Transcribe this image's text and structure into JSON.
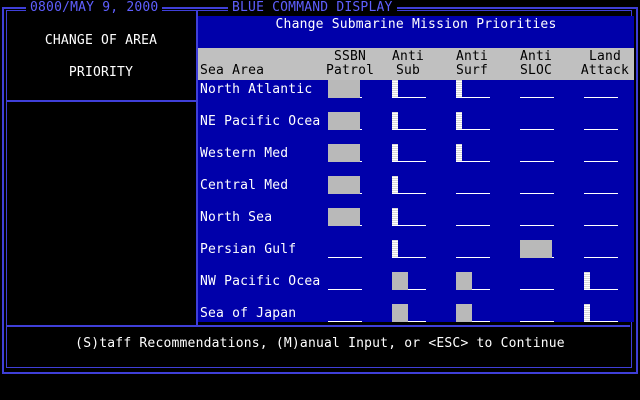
{
  "top_bar": {
    "datetime": "0800/MAY  9, 2000",
    "display_name": "BLUE  COMMAND DISPLAY"
  },
  "left_panel": {
    "line1": "CHANGE OF AREA",
    "line2": "PRIORITY"
  },
  "panel": {
    "title": "Change Submarine Mission Priorities",
    "column_headers": [
      {
        "top": "",
        "bottom": "Sea Area"
      },
      {
        "top": "SSBN",
        "bottom": "Patrol"
      },
      {
        "top": "Anti",
        "bottom": "Sub"
      },
      {
        "top": "Anti",
        "bottom": "Surf"
      },
      {
        "top": "Anti",
        "bottom": "SLOC"
      },
      {
        "top": "Land",
        "bottom": "Attack"
      }
    ],
    "rows": [
      {
        "area": "North Atlantic",
        "levels": [
          1.0,
          0.2,
          0.2,
          0,
          0
        ]
      },
      {
        "area": "NE Pacific Ocea",
        "levels": [
          1.0,
          0.2,
          0.2,
          0,
          0
        ]
      },
      {
        "area": "Western Med",
        "levels": [
          1.0,
          0.2,
          0.2,
          0,
          0
        ]
      },
      {
        "area": "Central Med",
        "levels": [
          1.0,
          0.2,
          0,
          0,
          0
        ]
      },
      {
        "area": "North Sea",
        "levels": [
          1.0,
          0.2,
          0,
          0,
          0
        ]
      },
      {
        "area": "Persian Gulf",
        "levels": [
          0,
          0.2,
          0,
          1.0,
          0
        ]
      },
      {
        "area": "NW Pacific Ocea",
        "levels": [
          0,
          0.5,
          0.5,
          0,
          0.2
        ]
      },
      {
        "area": "Sea of Japan",
        "levels": [
          0,
          0.5,
          0.5,
          0,
          0.2
        ]
      }
    ]
  },
  "footer": {
    "prompt": "(S)taff Recommendations, (M)anual Input, or <ESC> to Continue"
  },
  "colors": {
    "frame": "#3f3fd8",
    "panel_bg": "#0000aa",
    "header_bg": "#c0c0c0",
    "text_blue": "#5f5fff"
  }
}
